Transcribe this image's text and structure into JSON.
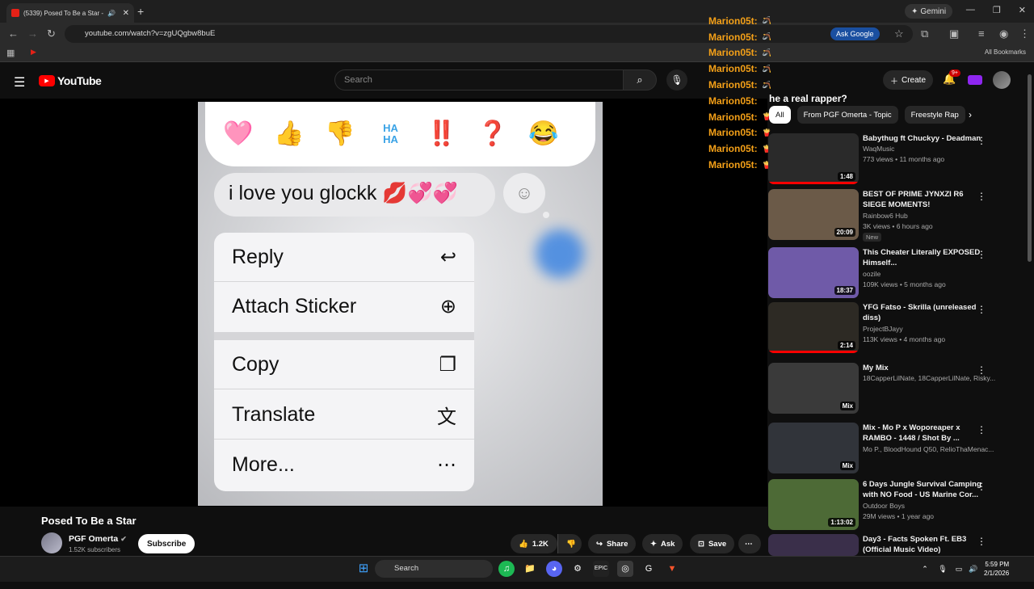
{
  "browser": {
    "tab_title": "(5339) Posed To Be a Star -",
    "gemini_label": "Gemini",
    "url": "youtube.com/watch?v=zgUQgbw8buE",
    "ask_google": "Ask Google",
    "all_bookmarks": "All Bookmarks"
  },
  "youtube": {
    "logo": "YouTube",
    "search_placeholder": "Search",
    "create_label": "Create",
    "notif_badge": "9+"
  },
  "video": {
    "reactions": [
      "🩷",
      "👍",
      "👎",
      "HA HA",
      "‼️",
      "❓",
      "😂"
    ],
    "message": "i love you glockk 💋💞💞",
    "menu": [
      {
        "label": "Reply",
        "icon": "↩"
      },
      {
        "label": "Attach Sticker",
        "icon": "⊕"
      },
      {
        "label": "Copy",
        "icon": "❐"
      },
      {
        "label": "Translate",
        "icon": "文"
      },
      {
        "label": "More...",
        "icon": "⋯"
      }
    ],
    "title": "Posed To Be a Star",
    "channel": "PGF Omerta",
    "subscribers": "1.52K subscribers",
    "subscribe": "Subscribe",
    "likes": "1.2K",
    "share": "Share",
    "ask": "Ask",
    "save": "Save"
  },
  "chat": {
    "user": "Marion05t:",
    "lines": [
      "🪃",
      "🪃",
      "🪃",
      "🪃",
      "🪃",
      "he a real rapper?",
      "🍟",
      "🍟",
      "🍟",
      "🍟"
    ]
  },
  "chips": [
    "All",
    "From PGF Omerta - Topic",
    "Freestyle Rap"
  ],
  "recommendations": [
    {
      "title": "Babythug ft Chuckyy - Deadman",
      "channel": "WaqMusic",
      "meta": "773 views • 11 months ago",
      "duration": "1:48",
      "thumb": "#2a2a2a"
    },
    {
      "title": "BEST OF PRIME JYNXZI R6 SIEGE MOMENTS!",
      "channel": "Rainbow6 Hub",
      "meta": "3K views • 6 hours ago",
      "duration": "20:09",
      "badge": "New",
      "thumb": "#6b5a48"
    },
    {
      "title": "This Cheater Literally EXPOSED Himself...",
      "channel": "oozile",
      "meta": "109K views • 5 months ago",
      "duration": "18:37",
      "thumb": "#6f5aa8"
    },
    {
      "title": "YFG Fatso - Skrilla (unreleased diss)",
      "channel": "ProjectBJayy",
      "meta": "113K views • 4 months ago",
      "duration": "2:14",
      "thumb": "#2d2a24"
    },
    {
      "title": "My Mix",
      "channel": "18CapperLilNate, 18CapperLilNate, Risky...",
      "meta": "",
      "duration": "Mix",
      "thumb": "#3a3a3a"
    },
    {
      "title": "Mix - Mo P x Woporeaper x RAMBO - 1448  / Shot By ...",
      "channel": "Mo P., BloodHound Q50, RelioThaMenac...",
      "meta": "",
      "duration": "Mix",
      "thumb": "#31343a"
    },
    {
      "title": "6 Days Jungle Survival Camping with NO Food - US Marine Cor...",
      "channel": "Outdoor Boys",
      "meta": "29M views • 1 year ago",
      "duration": "1:13:02",
      "thumb": "#4d6a36"
    },
    {
      "title": "Day3 - Facts Spoken Ft. EB3 (Official Music Video)",
      "channel": "",
      "meta": "",
      "duration": "",
      "thumb": "#3a2f4a"
    }
  ],
  "taskbar": {
    "search": "Search",
    "time": "5:59 PM",
    "date": "2/1/2026"
  }
}
